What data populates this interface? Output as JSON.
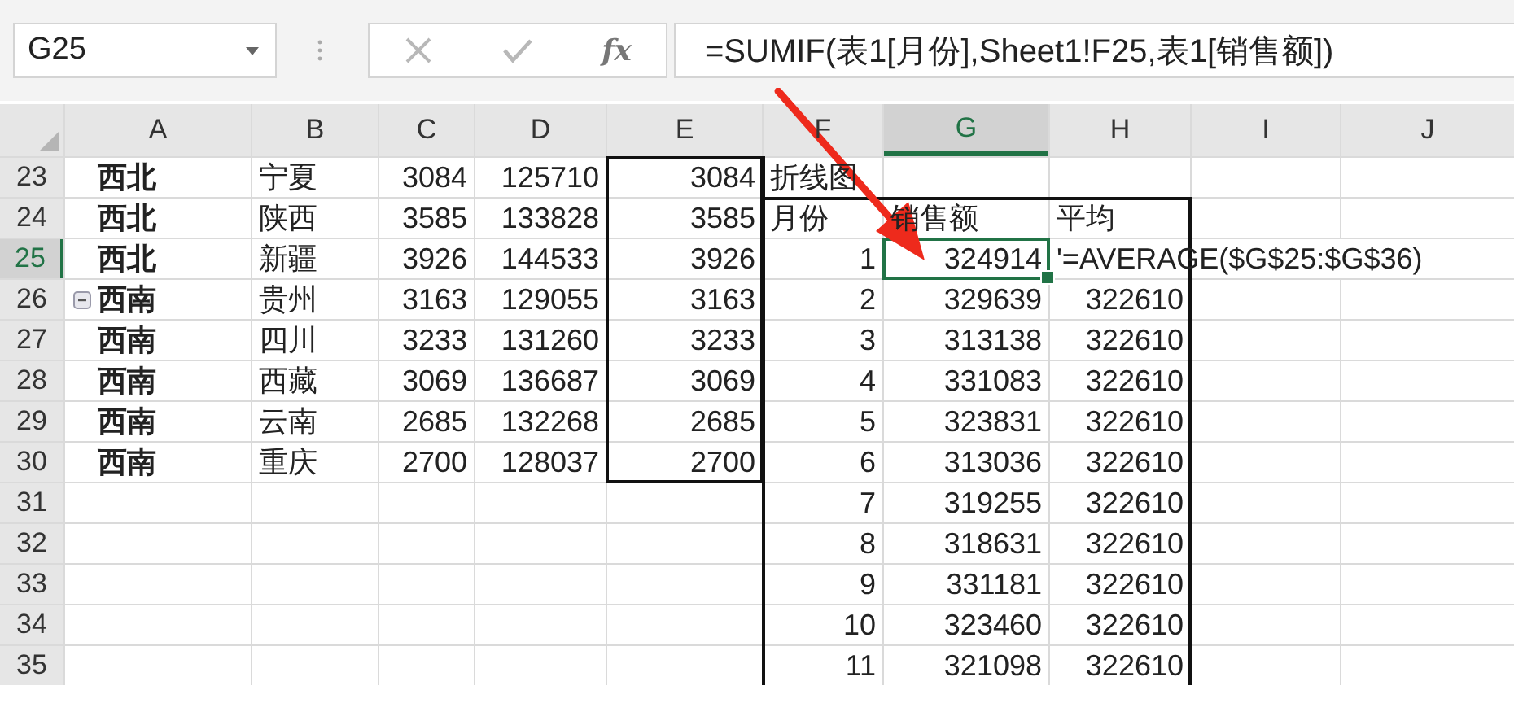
{
  "name_box": "G25",
  "function_label": "fx",
  "formula": "=SUMIF(表1[月份],Sheet1!F25,表1[销售额])",
  "columns": [
    {
      "label": "A",
      "selected": false,
      "bold": true
    },
    {
      "label": "B",
      "selected": false,
      "bold": false
    },
    {
      "label": "C",
      "selected": false,
      "bold": false
    },
    {
      "label": "D",
      "selected": false,
      "bold": false
    },
    {
      "label": "E",
      "selected": false,
      "bold": false
    },
    {
      "label": "F",
      "selected": false,
      "bold": false
    },
    {
      "label": "G",
      "selected": true,
      "bold": false
    },
    {
      "label": "H",
      "selected": false,
      "bold": false
    },
    {
      "label": "I",
      "selected": false
    },
    {
      "label": "J",
      "selected": false
    }
  ],
  "rows": [
    {
      "number": "23",
      "selected": false,
      "collapse_button": false,
      "cells": {
        "A": "西北",
        "B": "宁夏",
        "C": "3084",
        "D": "125710",
        "E": "3084",
        "F": "折线图"
      }
    },
    {
      "number": "24",
      "selected": false,
      "collapse_button": false,
      "cells": {
        "A": "西北",
        "B": "陕西",
        "C": "3585",
        "D": "133828",
        "E": "3585",
        "F": "月份",
        "G": "销售额",
        "H": "平均"
      }
    },
    {
      "number": "25",
      "selected": true,
      "collapse_button": false,
      "cells": {
        "A": "西北",
        "B": "新疆",
        "C": "3926",
        "D": "144533",
        "E": "3926",
        "F": "1",
        "G": "324914",
        "H": "'=AVERAGE($G$25:$G$36)"
      }
    },
    {
      "number": "26",
      "selected": false,
      "collapse_button": true,
      "cells": {
        "A": "西南",
        "B": "贵州",
        "C": "3163",
        "D": "129055",
        "E": "3163",
        "F": "2",
        "G": "329639",
        "H": "322610"
      }
    },
    {
      "number": "27",
      "selected": false,
      "collapse_button": false,
      "cells": {
        "A": "西南",
        "B": "四川",
        "C": "3233",
        "D": "131260",
        "E": "3233",
        "F": "3",
        "G": "313138",
        "H": "322610"
      }
    },
    {
      "number": "28",
      "selected": false,
      "collapse_button": false,
      "cells": {
        "A": "西南",
        "B": "西藏",
        "C": "3069",
        "D": "136687",
        "E": "3069",
        "F": "4",
        "G": "331083",
        "H": "322610"
      }
    },
    {
      "number": "29",
      "selected": false,
      "collapse_button": false,
      "cells": {
        "A": "西南",
        "B": "云南",
        "C": "2685",
        "D": "132268",
        "E": "2685",
        "F": "5",
        "G": "323831",
        "H": "322610"
      }
    },
    {
      "number": "30",
      "selected": false,
      "collapse_button": false,
      "cells": {
        "A": "西南",
        "B": "重庆",
        "C": "2700",
        "D": "128037",
        "E": "2700",
        "F": "6",
        "G": "313036",
        "H": "322610"
      }
    },
    {
      "number": "31",
      "selected": false,
      "collapse_button": false,
      "cells": {
        "F": "7",
        "G": "319255",
        "H": "322610"
      }
    },
    {
      "number": "32",
      "selected": false,
      "collapse_button": false,
      "cells": {
        "F": "8",
        "G": "318631",
        "H": "322610"
      }
    },
    {
      "number": "33",
      "selected": false,
      "collapse_button": false,
      "cells": {
        "F": "9",
        "G": "331181",
        "H": "322610"
      }
    },
    {
      "number": "34",
      "selected": false,
      "collapse_button": false,
      "cells": {
        "F": "10",
        "G": "323460",
        "H": "322610"
      }
    },
    {
      "number": "35",
      "selected": false,
      "collapse_button": false,
      "cells": {
        "F": "11",
        "G": "321098",
        "H": "322610"
      }
    }
  ]
}
